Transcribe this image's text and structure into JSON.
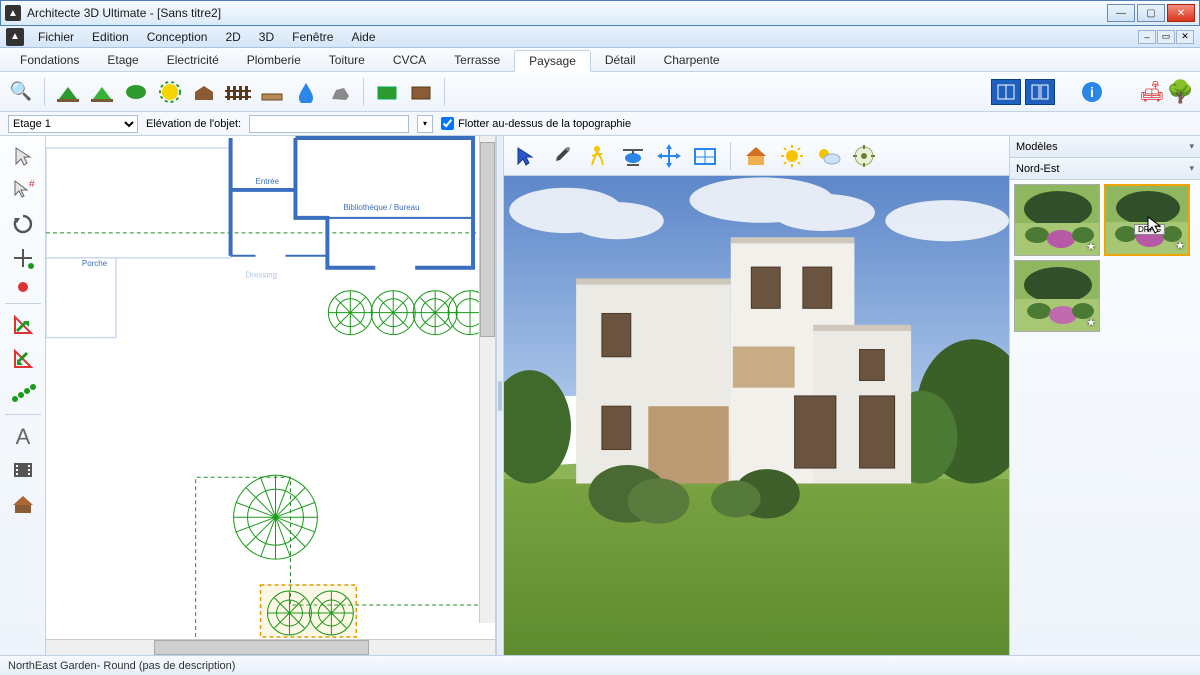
{
  "window": {
    "title": "Architecte 3D Ultimate - [Sans titre2]"
  },
  "menu": [
    "Fichier",
    "Edition",
    "Conception",
    "2D",
    "3D",
    "Fenêtre",
    "Aide"
  ],
  "tabs": [
    "Fondations",
    "Etage",
    "Electricité",
    "Plomberie",
    "Toiture",
    "CVCA",
    "Terrasse",
    "Paysage",
    "Détail",
    "Charpente"
  ],
  "active_tab": "Paysage",
  "subbar": {
    "floor_label": "Etage 1",
    "elevation_label": "Elévation de l'objet:",
    "elevation_value": "",
    "float_checked": true,
    "float_label": "Flotter au-dessus de la topographie"
  },
  "plan_labels": {
    "porche": "Porche",
    "entree": "Entrée",
    "biblio": "Bibliothèque / Bureau",
    "dressing": "Dressing"
  },
  "sidebar": {
    "models_label": "Modèles",
    "group_label": "Nord-Est",
    "drag_hint": "DRAG"
  },
  "status": "NorthEast Garden- Round (pas de description)",
  "icons": {
    "magnifier": "🔍",
    "layers": "▦",
    "grass": "grass",
    "water": "💧",
    "rock": "rock",
    "tree": "🌳",
    "fence": "▥",
    "path": "path",
    "pond": "pond",
    "hill": "hill",
    "sign": "sign",
    "selarrow": "↖",
    "eyedrop": "eyedrop",
    "walker": "🚶",
    "heli": "🚁",
    "nav3d": "✥",
    "floor3d": "⬚",
    "house": "🏠",
    "sun": "☀",
    "cloud": "⛅",
    "gear": "⚙",
    "info": "ℹ",
    "sofa": "🛋",
    "tree2": "🌳"
  }
}
